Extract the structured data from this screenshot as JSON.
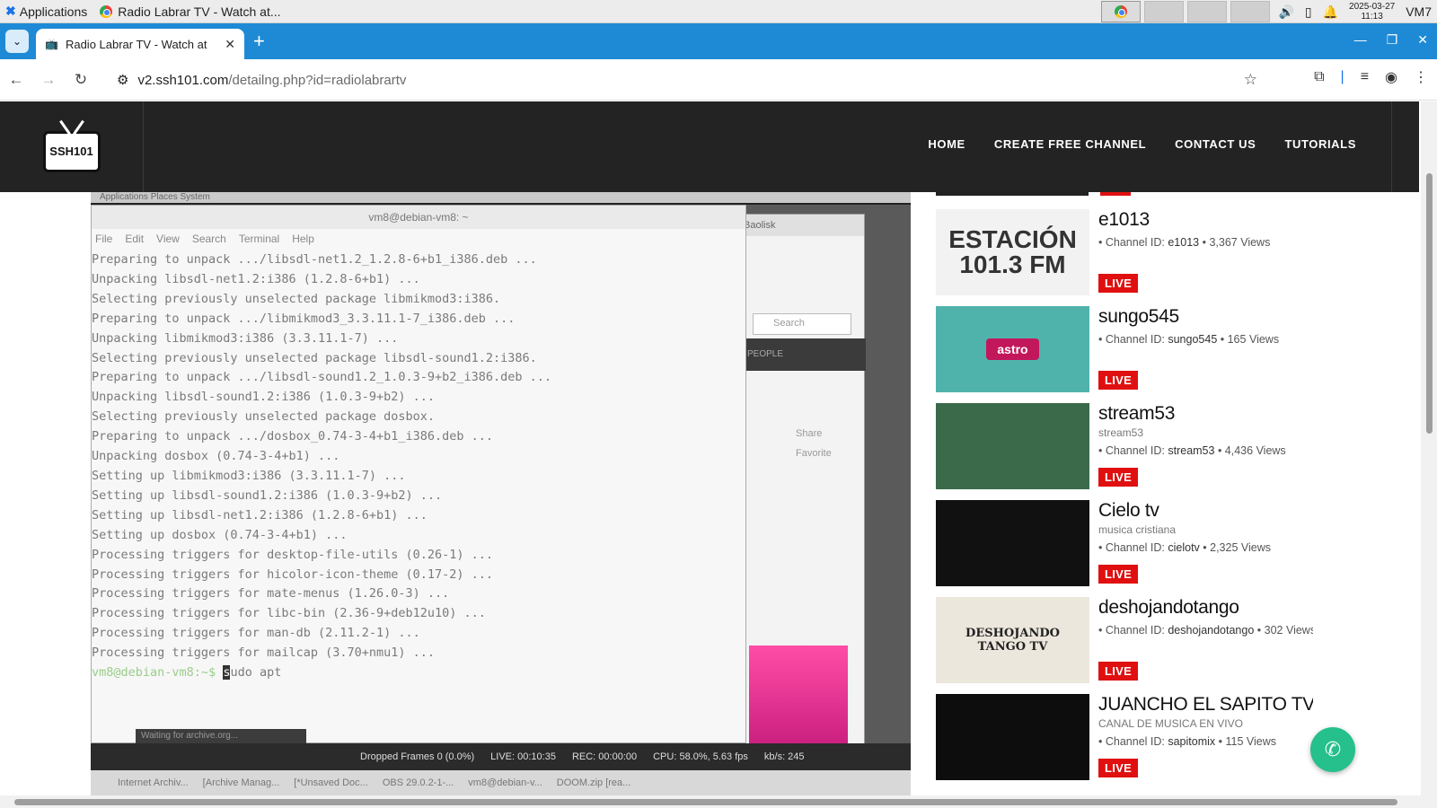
{
  "os_taskbar": {
    "apps_label": "Applications",
    "window_task": "Radio Labrar TV - Watch at...",
    "clock_date": "2025-03-27",
    "clock_time": "11:13",
    "vm_label": "VM7"
  },
  "browser": {
    "tab_title": "Radio Labrar TV - Watch at",
    "url_host": "v2.ssh101.com",
    "url_path": "/detailng.php?id=radiolabrartv"
  },
  "site": {
    "logo_text": "SSH101",
    "menu": [
      "HOME",
      "CREATE FREE CHANNEL",
      "CONTACT US",
      "TUTORIALS"
    ]
  },
  "stream": {
    "desktop_topbar": "Applications  Places  System",
    "terminal_title": "vm8@debian-vm8: ~",
    "terminal_menu": [
      "File",
      "Edit",
      "View",
      "Search",
      "Terminal",
      "Help"
    ],
    "terminal_lines": [
      "Preparing to unpack .../libsdl-net1.2_1.2.8-6+b1_i386.deb ...",
      "Unpacking libsdl-net1.2:i386 (1.2.8-6+b1) ...",
      "Selecting previously unselected package libmikmod3:i386.",
      "Preparing to unpack .../libmikmod3_3.3.11.1-7_i386.deb ...",
      "Unpacking libmikmod3:i386 (3.3.11.1-7) ...",
      "Selecting previously unselected package libsdl-sound1.2:i386.",
      "Preparing to unpack .../libsdl-sound1.2_1.0.3-9+b2_i386.deb ...",
      "Unpacking libsdl-sound1.2:i386 (1.0.3-9+b2) ...",
      "Selecting previously unselected package dosbox.",
      "Preparing to unpack .../dosbox_0.74-3-4+b1_i386.deb ...",
      "Unpacking dosbox (0.74-3-4+b1) ...",
      "Setting up libmikmod3:i386 (3.3.11.1-7) ...",
      "Setting up libsdl-sound1.2:i386 (1.0.3-9+b2) ...",
      "Setting up libsdl-net1.2:i386 (1.2.8-6+b1) ...",
      "Setting up dosbox (0.74-3-4+b1) ...",
      "Processing triggers for desktop-file-utils (0.26-1) ...",
      "Processing triggers for hicolor-icon-theme (0.17-2) ...",
      "Processing triggers for mate-menus (1.26.0-3) ...",
      "Processing triggers for libc-bin (2.36-9+deb12u10) ...",
      "Processing triggers for man-db (2.11.2-1) ...",
      "Processing triggers for mailcap (3.70+nmu1) ..."
    ],
    "prompt": "vm8@debian-vm8:~$ ",
    "command_cursor_char": "s",
    "command_rest": "udo apt",
    "side_browser_title": "Baolisk",
    "side_search_placeholder": "Search",
    "side_people": "PEOPLE",
    "side_share": "Share",
    "side_favorite": "Favorite",
    "obs_waiting": "Waiting for archive.org...",
    "obs_status": [
      "Dropped Frames 0 (0.0%)",
      "LIVE: 00:10:35",
      "REC: 00:00:00",
      "CPU: 58.0%, 5.63 fps",
      "kb/s: 245"
    ],
    "desktop_tasks": [
      "Internet Archiv...",
      "[Archive Manag...",
      "[*Unsaved Doc...",
      "OBS 29.0.2-1-...",
      "vm8@debian-v...",
      "DOOM.zip [rea..."
    ]
  },
  "channels": [
    {
      "name": "e1013",
      "desc": "",
      "channel_id_label": "Channel ID:",
      "channel_id": "e1013",
      "views": "3,367",
      "views_label": "Views",
      "live": "LIVE",
      "thumb_text": "ESTACIÓN 101.3 FM",
      "thumb_bg": "#f2f2f2"
    },
    {
      "name": "sungo545",
      "desc": "",
      "channel_id_label": "Channel ID:",
      "channel_id": "sungo545",
      "views": "165",
      "views_label": "Views",
      "live": "LIVE",
      "thumb_text": "astro",
      "thumb_bg": "#4fb3ac"
    },
    {
      "name": "stream53",
      "desc": "stream53",
      "channel_id_label": "Channel ID:",
      "channel_id": "stream53",
      "views": "4,436",
      "views_label": "Views",
      "live": "LIVE",
      "thumb_text": "",
      "thumb_bg": "#3a6a4a"
    },
    {
      "name": "Cielo tv",
      "desc": "musica cristiana",
      "channel_id_label": "Channel ID:",
      "channel_id": "cielotv",
      "views": "2,325",
      "views_label": "Views",
      "live": "LIVE",
      "thumb_text": "",
      "thumb_bg": "#111111"
    },
    {
      "name": "deshojandotango",
      "desc": "",
      "channel_id_label": "Channel ID:",
      "channel_id": "deshojandotango",
      "views": "302",
      "views_label": "Views",
      "live": "LIVE",
      "thumb_text": "DESHOJANDO TANGO TV",
      "thumb_bg": "#ece7dc"
    },
    {
      "name": "JUANCHO EL SAPITO TV",
      "desc": "CANAL DE MUSICA EN VIVO",
      "channel_id_label": "Channel ID:",
      "channel_id": "sapitomix",
      "views": "115",
      "views_label": "Views",
      "live": "LIVE",
      "thumb_text": "",
      "thumb_bg": "#0d0d0d"
    }
  ],
  "colors": {
    "tab_strip": "#1e8ad6",
    "header_bg": "#232323",
    "live_red": "#e01010",
    "whatsapp_green": "#25c08b"
  }
}
